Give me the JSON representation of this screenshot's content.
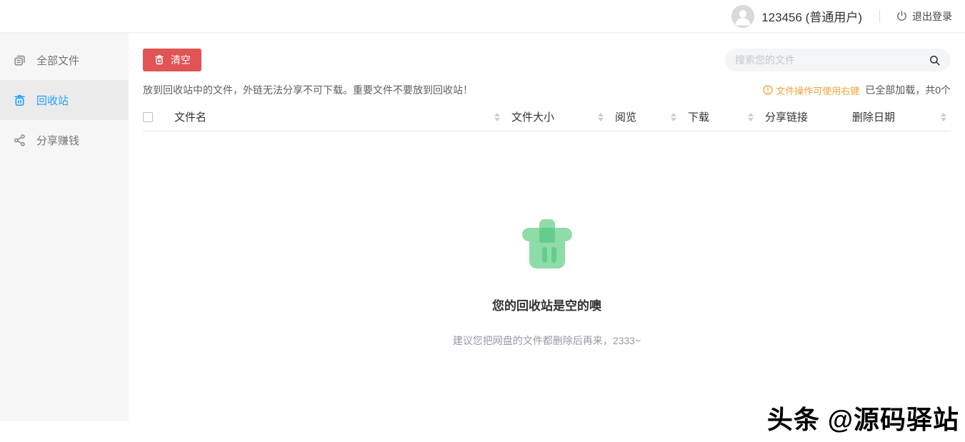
{
  "header": {
    "username": "123456 (普通用户)",
    "logout": "退出登录"
  },
  "sidebar": {
    "items": [
      {
        "label": "全部文件",
        "icon": "files-icon",
        "active": false
      },
      {
        "label": "回收站",
        "icon": "trash-icon",
        "active": true
      },
      {
        "label": "分享赚钱",
        "icon": "share-icon",
        "active": false
      }
    ]
  },
  "toolbar": {
    "clear_label": "清空",
    "search_placeholder": "搜索您的文件"
  },
  "notice": {
    "message": "放到回收站中的文件，外链无法分享不可下载。重要文件不要放到回收站！",
    "tip": "文件操作可使用右键",
    "load_status": "已全部加载，共0个"
  },
  "table": {
    "columns": [
      {
        "label": "文件名",
        "sortable": true
      },
      {
        "label": "文件大小",
        "sortable": true
      },
      {
        "label": "阅览",
        "sortable": true
      },
      {
        "label": "下载",
        "sortable": true
      },
      {
        "label": "分享链接",
        "sortable": false
      },
      {
        "label": "删除日期",
        "sortable": true
      }
    ],
    "rows": []
  },
  "empty_state": {
    "title": "您的回收站是空的噢",
    "subtitle": "建议您把网盘的文件都删除后再来，2333~"
  },
  "watermark": "头条 @源码驿站",
  "colors": {
    "accent_blue": "#1e9fff",
    "danger_red": "#e05454",
    "warning_orange": "#f2a33c",
    "success_green_light": "#8fdca8",
    "success_green_dark": "#64cd8d",
    "sidebar_bg": "#f6f6f6",
    "sidebar_active_bg": "#ebebeb"
  }
}
